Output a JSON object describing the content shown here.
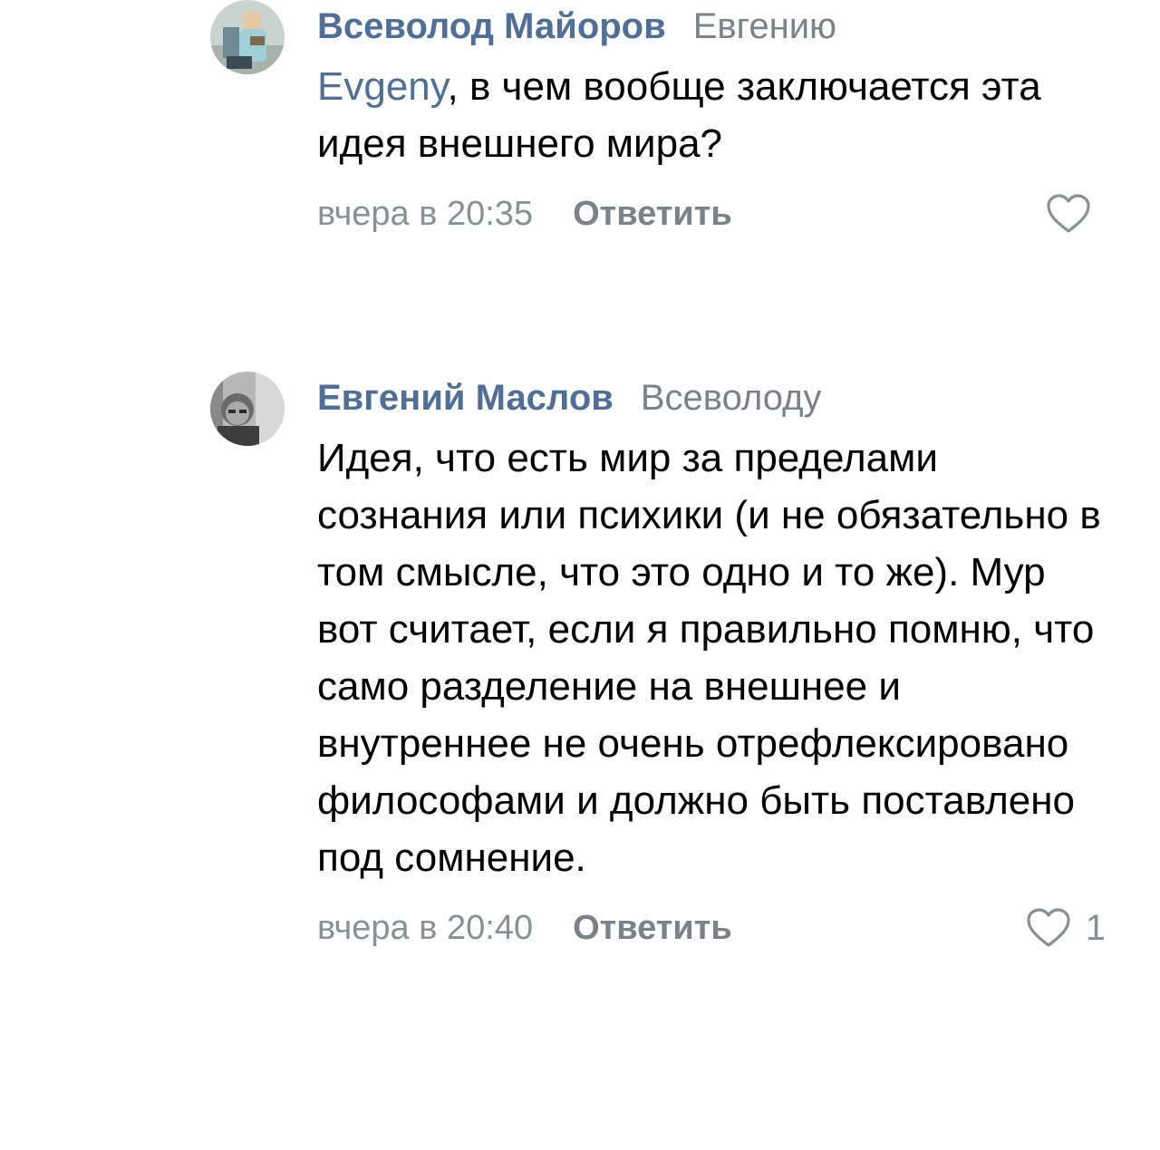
{
  "comments": [
    {
      "author": "Всеволод Майоров",
      "reply_to": "Евгению",
      "mention": "Evgeny",
      "text_after_mention": ", в чем вообще заключается эта идея внешнего мира?",
      "time": "вчера в 20:35",
      "reply_label": "Ответить",
      "like_icon": "heart-outline-icon",
      "like_count": ""
    },
    {
      "author": "Евгений Маслов",
      "reply_to": "Всеволоду",
      "text": "Идея, что есть мир за пределами сознания или психики (и не обязательно в том смысле, что это одно и то же). Мур вот считает, если я правильно помню, что само разделение на внешнее и внутреннее не очень отрефлексировано философами и должно быть поставлено под сомнение.",
      "time": "вчера в 20:40",
      "reply_label": "Ответить",
      "like_icon": "heart-outline-icon",
      "like_count": "1"
    }
  ],
  "colors": {
    "author": "#4f6f99",
    "secondary": "#7c8287",
    "meta": "#8c9095",
    "text": "#000000",
    "background": "#ffffff"
  }
}
